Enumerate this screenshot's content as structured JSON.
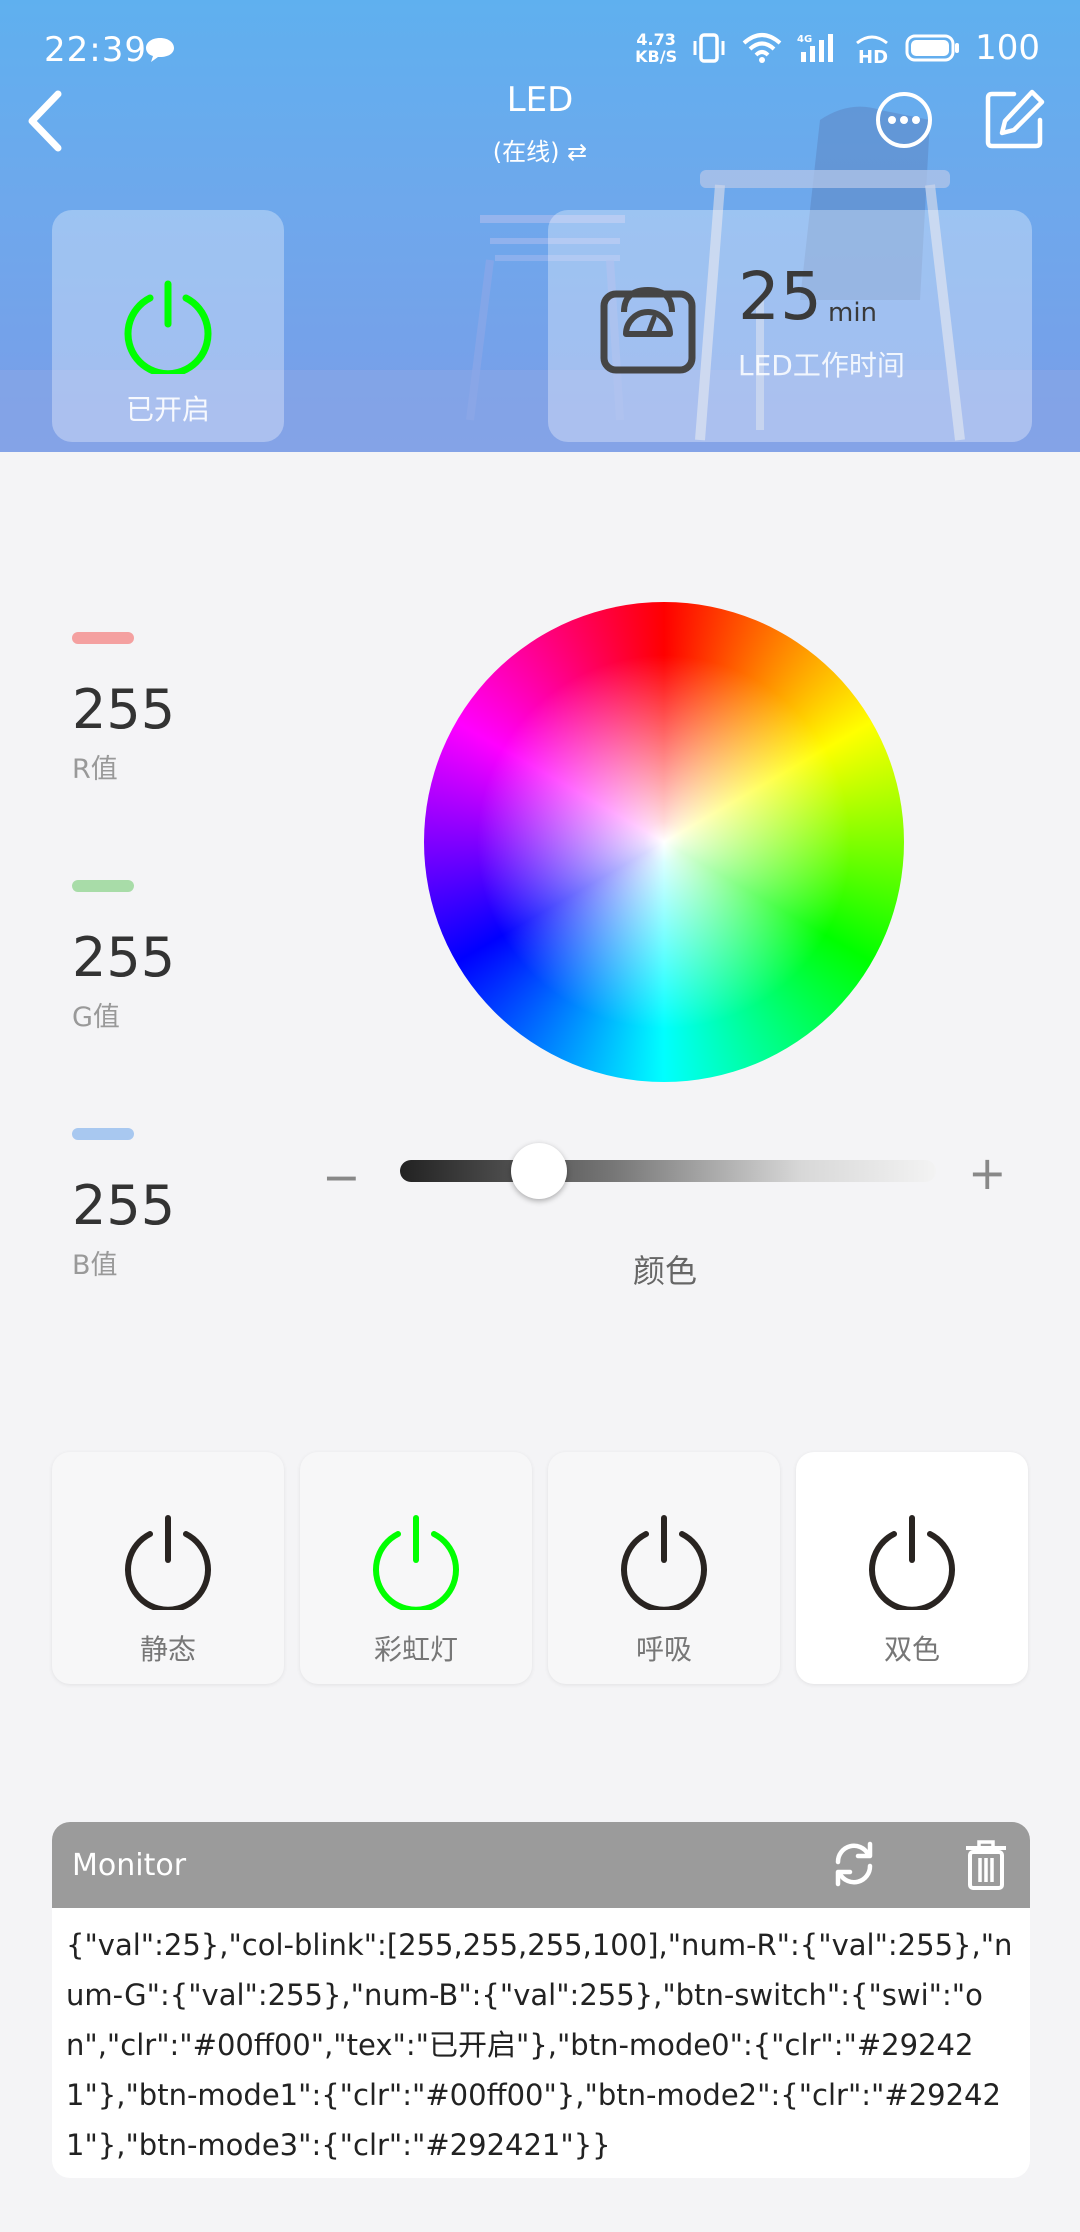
{
  "status_bar": {
    "time": "22:39",
    "speed_value": "4.73",
    "speed_unit": "KB/S",
    "battery": "100"
  },
  "nav": {
    "title": "LED",
    "subtitle": "(在线) ⇄"
  },
  "power_card": {
    "label": "已开启",
    "color": "#00ff00"
  },
  "timer_card": {
    "value": "25",
    "unit": "min",
    "caption": "LED工作时间"
  },
  "rgb": [
    {
      "value": "255",
      "label": "R值",
      "color": "#f4a0a0"
    },
    {
      "value": "255",
      "label": "G值",
      "color": "#a8dca8"
    },
    {
      "value": "255",
      "label": "B值",
      "color": "#a8c8f0"
    }
  ],
  "slider": {
    "minus": "−",
    "plus": "+",
    "caption": "颜色",
    "level": 0.26
  },
  "modes": [
    {
      "label": "静态",
      "color": "#292421"
    },
    {
      "label": "彩虹灯",
      "color": "#00ff00"
    },
    {
      "label": "呼吸",
      "color": "#292421"
    },
    {
      "label": "双色",
      "color": "#292421"
    }
  ],
  "monitor": {
    "title": "Monitor",
    "log": "{\"val\":25},\"col-blink\":[255,255,255,100],\"num-R\":{\"val\":255},\"num-G\":{\"val\":255},\"num-B\":{\"val\":255},\"btn-switch\":{\"swi\":\"on\",\"clr\":\"#00ff00\",\"tex\":\"已开启\"},\"btn-mode0\":{\"clr\":\"#292421\"},\"btn-mode1\":{\"clr\":\"#00ff00\"},\"btn-mode2\":{\"clr\":\"#292421\"},\"btn-mode3\":{\"clr\":\"#292421\"}}"
  }
}
